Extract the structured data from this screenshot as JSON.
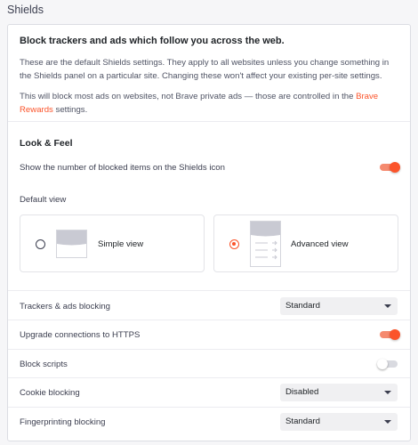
{
  "page": {
    "title": "Shields"
  },
  "intro": {
    "heading": "Block trackers and ads which follow you across the web.",
    "paragraph1": "These are the default Shields settings. They apply to all websites unless you change something in the Shields panel on a particular site. Changing these won't affect your existing per-site settings.",
    "paragraph2_before": "This will block most ads on websites, not Brave private ads — those are controlled in the ",
    "paragraph2_link": "Brave Rewards",
    "paragraph2_after": " settings."
  },
  "look_feel": {
    "title": "Look & Feel",
    "show_count_label": "Show the number of blocked items on the Shields icon",
    "show_count_on": true,
    "default_view_label": "Default view",
    "options": [
      {
        "label": "Simple view",
        "selected": false
      },
      {
        "label": "Advanced view",
        "selected": true
      }
    ]
  },
  "settings": {
    "trackers": {
      "label": "Trackers & ads blocking",
      "value": "Standard"
    },
    "https": {
      "label": "Upgrade connections to HTTPS",
      "on": true
    },
    "scripts": {
      "label": "Block scripts",
      "on": false
    },
    "cookies": {
      "label": "Cookie blocking",
      "value": "Disabled"
    },
    "fingerprinting": {
      "label": "Fingerprinting blocking",
      "value": "Standard"
    }
  },
  "colors": {
    "accent": "#fb542b",
    "toggle_on_track": "#f58a6f",
    "background": "#f6f6f8"
  }
}
